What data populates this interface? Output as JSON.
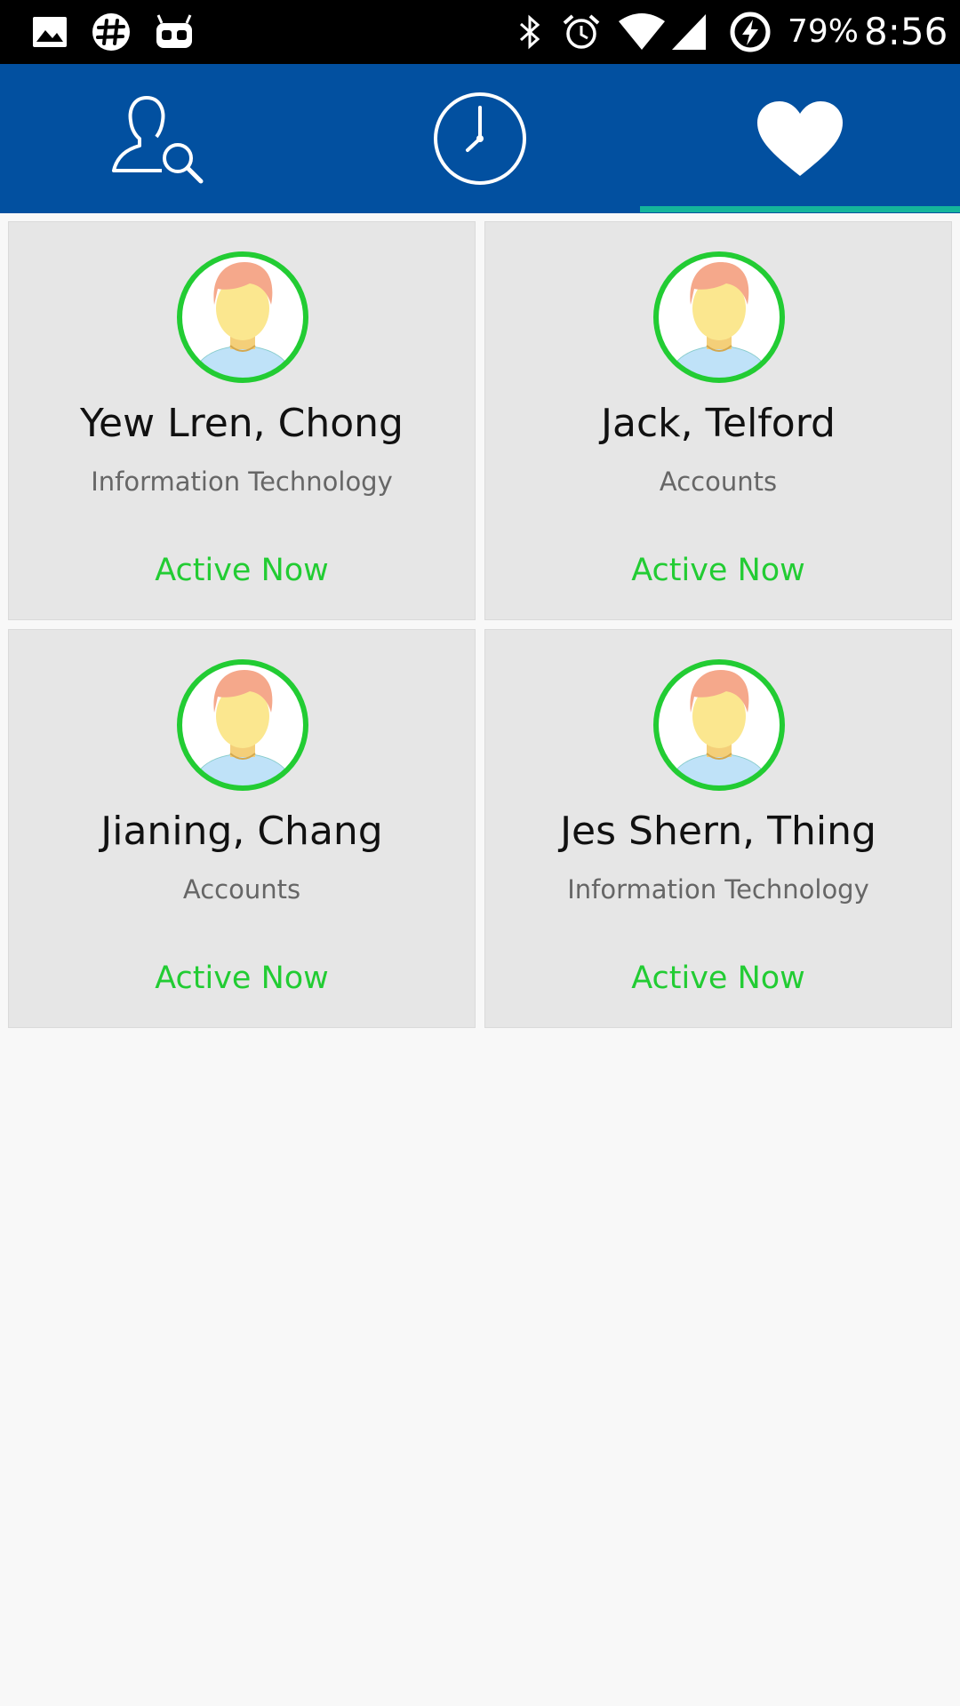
{
  "status_bar": {
    "left_icons": [
      "image-notification-icon",
      "slack-icon",
      "robot-icon"
    ],
    "right_icons": [
      "bluetooth-icon",
      "alarm-icon",
      "wifi-icon",
      "signal-icon",
      "battery-charging-icon"
    ],
    "battery": "79%",
    "time": "8:56"
  },
  "tabs": [
    {
      "icon": "user-search-icon",
      "active": false
    },
    {
      "icon": "clock-icon",
      "active": false
    },
    {
      "icon": "heart-icon",
      "active": true
    }
  ],
  "colors": {
    "tab_bar": "#0250a0",
    "tab_indicator": "#14b59b",
    "active_status": "#22cc33",
    "avatar_ring": "#22cc33"
  },
  "contacts": [
    {
      "name": "Yew Lren, Chong",
      "department": "Information Technology",
      "status": "Active Now"
    },
    {
      "name": "Jack, Telford",
      "department": "Accounts",
      "status": "Active Now"
    },
    {
      "name": "Jianing, Chang",
      "department": "Accounts",
      "status": "Active Now"
    },
    {
      "name": "Jes Shern, Thing",
      "department": "Information Technology",
      "status": "Active Now"
    }
  ]
}
